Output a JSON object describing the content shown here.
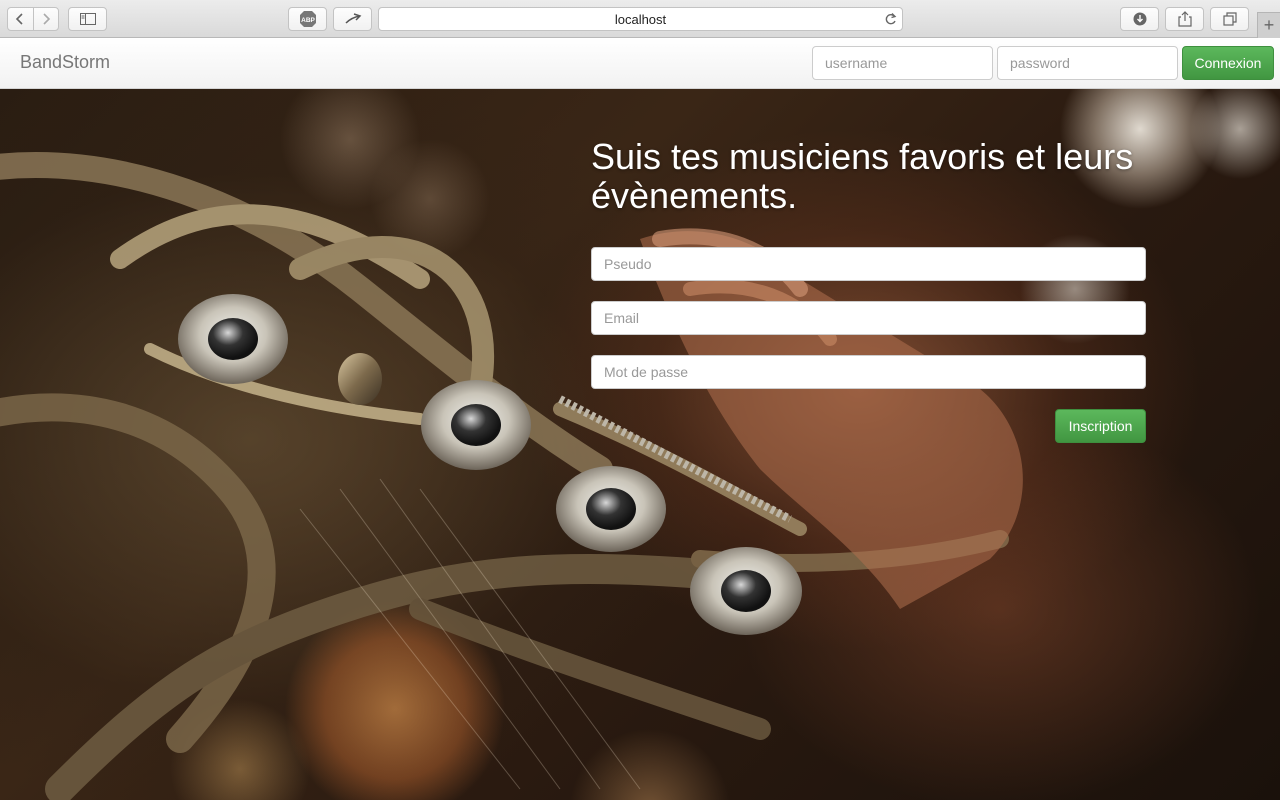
{
  "browser": {
    "url": "localhost",
    "icons": {
      "back": "chevron-left-icon",
      "forward": "chevron-right-icon",
      "sidebar": "sidebar-icon",
      "adblock": "abp-icon",
      "adblock_text": "ABP",
      "extension": "extension-icon",
      "reload": "reload-icon",
      "download": "download-icon",
      "share": "share-icon",
      "tabs": "tabs-icon",
      "new_tab": "plus-icon"
    }
  },
  "navbar": {
    "brand": "BandStorm",
    "username_placeholder": "username",
    "password_placeholder": "password",
    "login_label": "Connexion"
  },
  "hero": {
    "headline": "Suis tes musiciens favoris et leurs évènements.",
    "pseudo_placeholder": "Pseudo",
    "email_placeholder": "Email",
    "password_placeholder": "Mot de passe",
    "signup_label": "Inscription"
  },
  "colors": {
    "button_green": "#5cb85c",
    "brand_text": "#777777"
  }
}
